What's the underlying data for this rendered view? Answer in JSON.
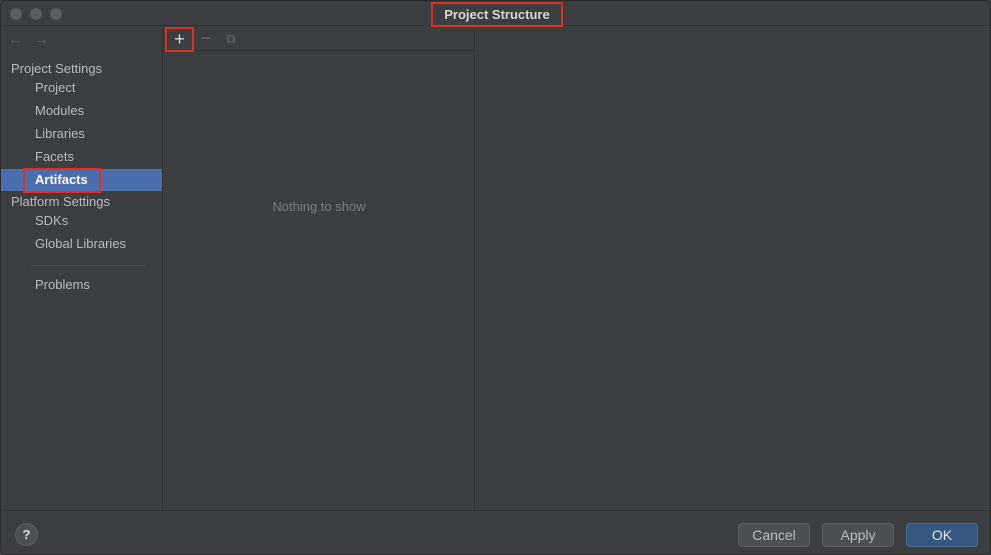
{
  "window": {
    "title": "Project Structure"
  },
  "nav": {
    "back_icon": "arrow-left",
    "forward_icon": "arrow-right",
    "back_glyph": "←",
    "forward_glyph": "→"
  },
  "sidebar": {
    "project_settings_header": "Project Settings",
    "project_settings_items": [
      "Project",
      "Modules",
      "Libraries",
      "Facets",
      "Artifacts"
    ],
    "selected": "Artifacts",
    "platform_settings_header": "Platform Settings",
    "platform_settings_items": [
      "SDKs",
      "Global Libraries"
    ],
    "problems": "Problems"
  },
  "toolbar": {
    "add_glyph": "+",
    "remove_glyph": "−",
    "copy_glyph": "⧉"
  },
  "middle": {
    "empty_text": "Nothing to show"
  },
  "footer": {
    "help_glyph": "?",
    "cancel_label": "Cancel",
    "apply_label": "Apply",
    "ok_label": "OK"
  },
  "colors": {
    "selection": "#4b6eaf",
    "highlight_box": "#e0301e",
    "ok_button": "#365880"
  }
}
